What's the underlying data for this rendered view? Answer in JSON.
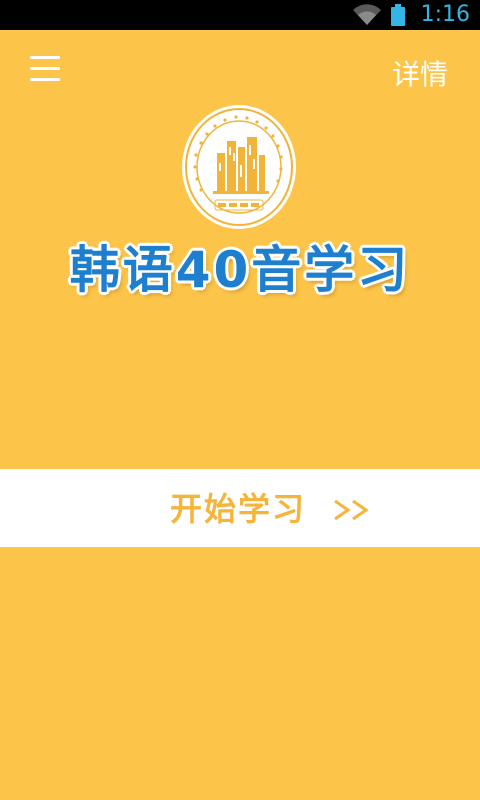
{
  "status_bar": {
    "time": "1:16",
    "wifi_icon": "wifi-icon",
    "battery_icon": "battery-icon",
    "accent_color": "#33b5e5"
  },
  "header": {
    "menu_icon": "hamburger-menu-icon",
    "details_label": "详情"
  },
  "logo": {
    "text_ring": "FOREIGN LANGUAGE TEACHING AND RESEARCH PRESS",
    "text_bottom": "外研社"
  },
  "app_title": "韩语40音学习",
  "start": {
    "label": "开始学习",
    "arrow_icon": "double-chevron-right-icon"
  },
  "colors": {
    "background": "#fcc54a",
    "title": "#1e7fcf",
    "start_label": "#f5b43a"
  }
}
